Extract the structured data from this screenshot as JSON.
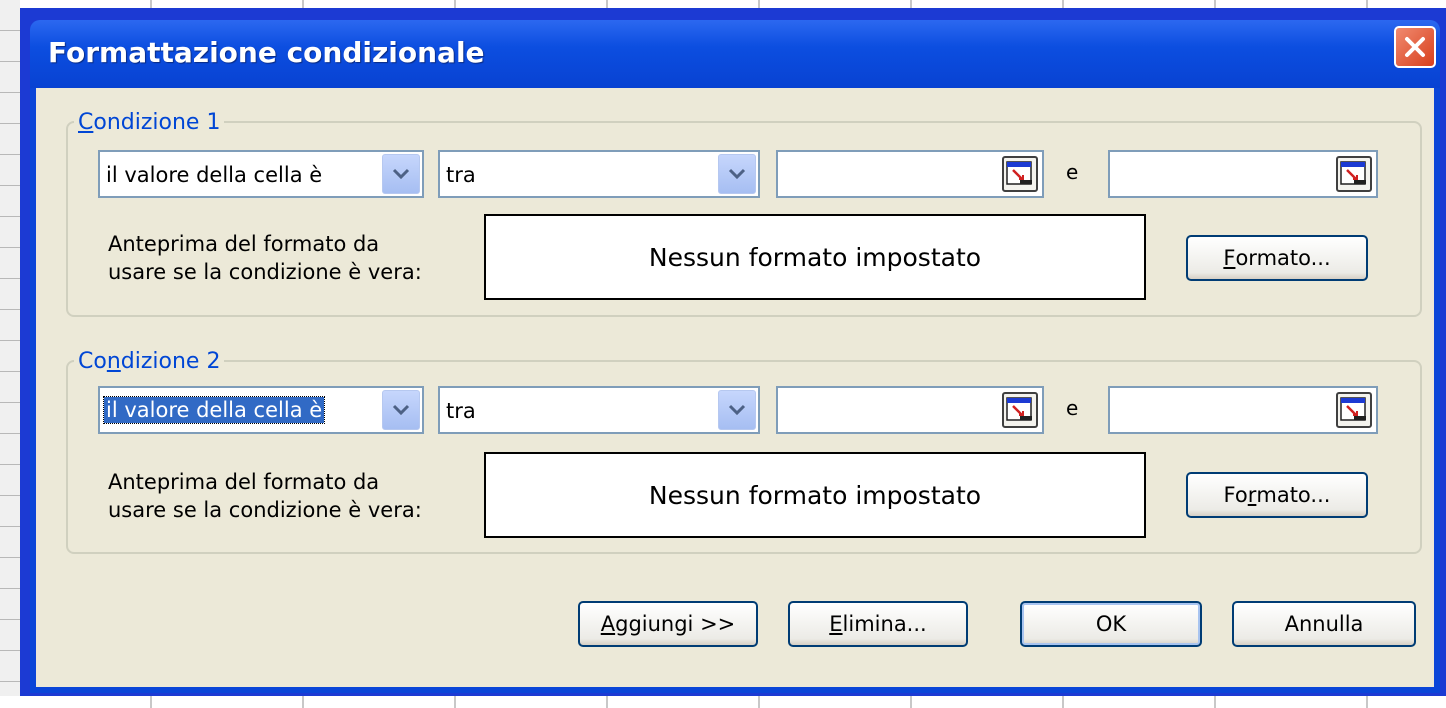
{
  "dialog": {
    "title": "Formattazione condizionale",
    "close_icon": "close-icon"
  },
  "conditions": [
    {
      "legend_pre": "",
      "legend_ul": "C",
      "legend_post": "ondizione 1",
      "operator_type": "il valore della cella è",
      "operator": "tra",
      "value1": "",
      "conjunction": "e",
      "value2": "",
      "preview_label_line1": "Anteprima del formato da",
      "preview_label_line2": "usare se la condizione è vera:",
      "preview_text": "Nessun formato impostato",
      "format_pre": "",
      "format_ul": "F",
      "format_post": "ormato..."
    },
    {
      "legend_pre": "Co",
      "legend_ul": "n",
      "legend_post": "dizione 2",
      "operator_type": "il valore della cella è",
      "operator": "tra",
      "value1": "",
      "conjunction": "e",
      "value2": "",
      "preview_label_line1": "Anteprima del formato da",
      "preview_label_line2": "usare se la condizione è vera:",
      "preview_text": "Nessun formato impostato",
      "format_pre": "Fo",
      "format_ul": "r",
      "format_post": "mato..."
    }
  ],
  "buttons": {
    "add_ul": "A",
    "add_post": "ggiungi >>",
    "delete_ul": "E",
    "delete_post": "limina...",
    "ok": "OK",
    "cancel": "Annulla"
  },
  "colors": {
    "title_bar": "#0a46d8",
    "dialog_face": "#ece9d8",
    "legend_text": "#0046d5",
    "selection": "#316ac5",
    "close_button": "#d8401c"
  }
}
